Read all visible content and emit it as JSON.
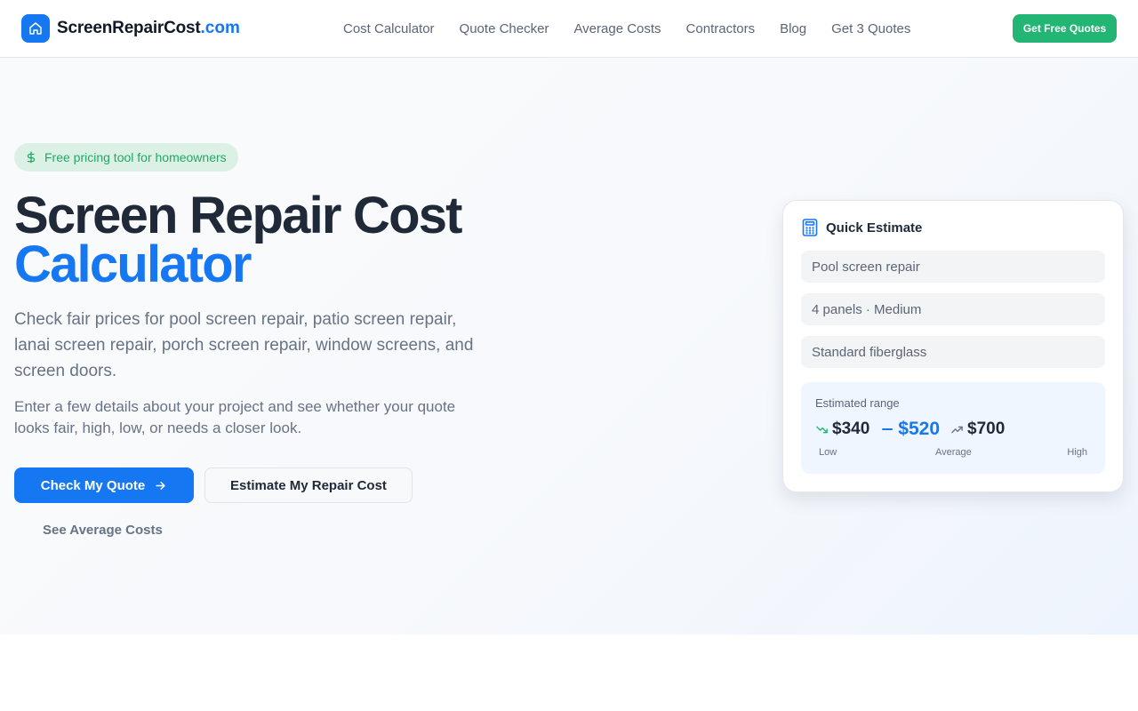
{
  "brand": {
    "name": "ScreenRepairCost",
    "tld": ".com",
    "icon": "home-icon"
  },
  "nav": {
    "links": [
      "Cost Calculator",
      "Quote Checker",
      "Average Costs",
      "Contractors",
      "Blog",
      "Get 3 Quotes"
    ],
    "cta": "Get Free Quotes"
  },
  "hero": {
    "pill": "Free pricing tool for homeowners",
    "pill_icon": "dollar-icon",
    "title": "Screen Repair Cost",
    "title_accent": "Calculator",
    "lead": "Check fair prices for pool screen repair, patio screen repair, lanai screen repair, porch screen repair, window screens, and screen doors.",
    "sub": "Enter a few details about your project and see whether your quote looks fair, high, low, or needs a closer look.",
    "primary_button": "Check My Quote",
    "secondary_button": "Estimate My Repair Cost",
    "link_button": "See Average Costs"
  },
  "estimate": {
    "title": "Quick Estimate",
    "icon": "calculator-icon",
    "fields": [
      "Pool screen repair",
      "4 panels · Medium",
      "Standard fiberglass"
    ],
    "range_label": "Estimated range",
    "low": "$340",
    "average": "$520",
    "high": "$700",
    "low_label": "Low",
    "average_label": "Average",
    "high_label": "High"
  },
  "colors": {
    "primary": "#1677f2",
    "success": "#22b573",
    "text_dark": "#1f2937",
    "text_muted": "#687386"
  }
}
